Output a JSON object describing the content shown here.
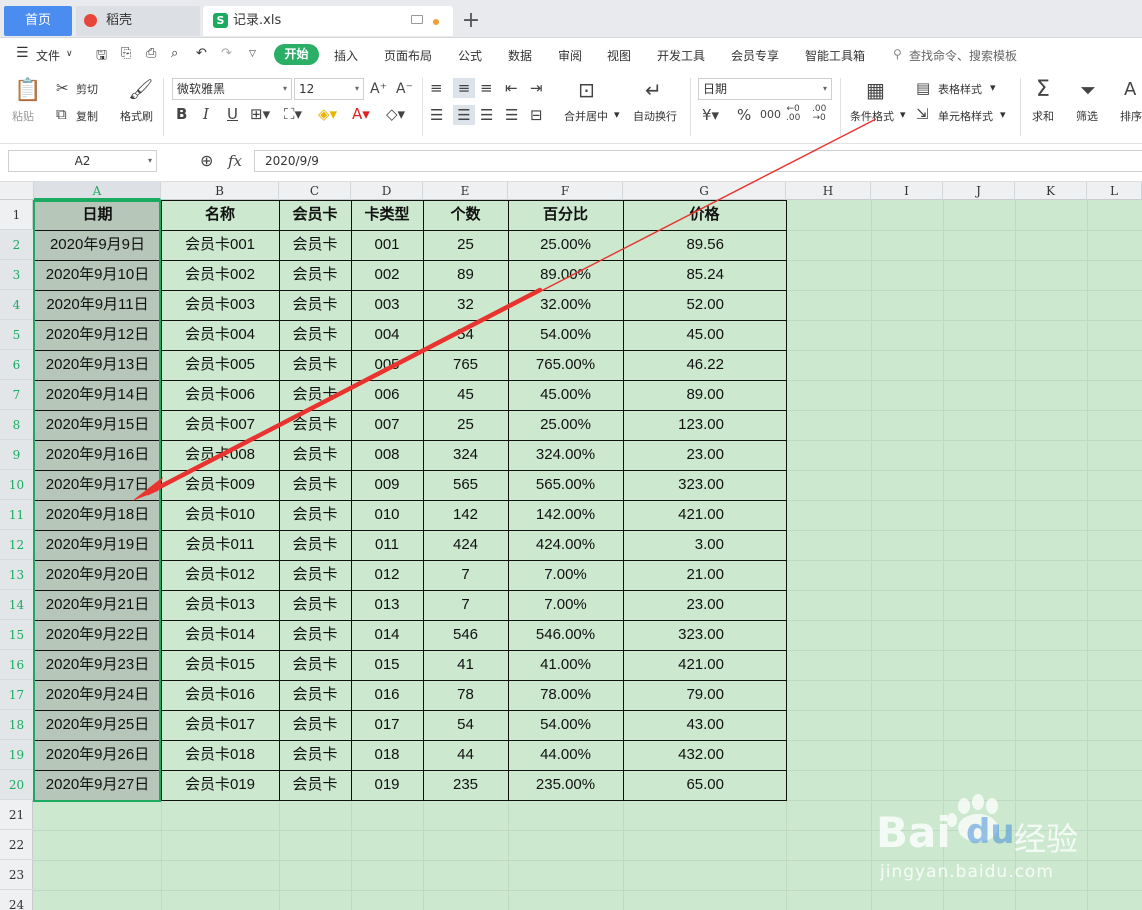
{
  "tabs": {
    "home": "首页",
    "daoke": "稻壳",
    "file": "记录.xls",
    "plus": "+"
  },
  "menu": {
    "file": "文件",
    "items": [
      "开始",
      "插入",
      "页面布局",
      "公式",
      "数据",
      "审阅",
      "视图",
      "开发工具",
      "会员专享",
      "智能工具箱"
    ],
    "search": "查找命令、搜索模板"
  },
  "ribbon": {
    "paste": "粘贴",
    "cut": "剪切",
    "copy": "复制",
    "format_painter": "格式刷",
    "font_name": "微软雅黑",
    "font_size": "12",
    "merge_center": "合并居中",
    "wrap": "自动换行",
    "number_format": "日期",
    "cond_format": "条件格式",
    "table_style": "表格样式",
    "cell_style": "单元格样式",
    "sum": "求和",
    "filter": "筛选",
    "sort": "排序"
  },
  "formula_bar": {
    "name_box": "A2",
    "fx": "fx",
    "value": "2020/9/9"
  },
  "columns": [
    "A",
    "B",
    "C",
    "D",
    "E",
    "F",
    "G",
    "H",
    "I",
    "J",
    "K",
    "L"
  ],
  "rows": [
    "1",
    "2",
    "3",
    "4",
    "5",
    "6",
    "7",
    "8",
    "9",
    "10",
    "11",
    "12",
    "13",
    "14",
    "15",
    "16",
    "17",
    "18",
    "19",
    "20",
    "21",
    "22",
    "23",
    "24"
  ],
  "table": {
    "headers": [
      "日期",
      "名称",
      "会员卡",
      "卡类型",
      "个数",
      "百分比",
      "价格"
    ],
    "data": [
      [
        "2020年9月9日",
        "会员卡001",
        "会员卡",
        "001",
        "25",
        "25.00%",
        "89.56"
      ],
      [
        "2020年9月10日",
        "会员卡002",
        "会员卡",
        "002",
        "89",
        "89.00%",
        "85.24"
      ],
      [
        "2020年9月11日",
        "会员卡003",
        "会员卡",
        "003",
        "32",
        "32.00%",
        "52.00"
      ],
      [
        "2020年9月12日",
        "会员卡004",
        "会员卡",
        "004",
        "54",
        "54.00%",
        "45.00"
      ],
      [
        "2020年9月13日",
        "会员卡005",
        "会员卡",
        "005",
        "765",
        "765.00%",
        "46.22"
      ],
      [
        "2020年9月14日",
        "会员卡006",
        "会员卡",
        "006",
        "45",
        "45.00%",
        "89.00"
      ],
      [
        "2020年9月15日",
        "会员卡007",
        "会员卡",
        "007",
        "25",
        "25.00%",
        "123.00"
      ],
      [
        "2020年9月16日",
        "会员卡008",
        "会员卡",
        "008",
        "324",
        "324.00%",
        "23.00"
      ],
      [
        "2020年9月17日",
        "会员卡009",
        "会员卡",
        "009",
        "565",
        "565.00%",
        "323.00"
      ],
      [
        "2020年9月18日",
        "会员卡010",
        "会员卡",
        "010",
        "142",
        "142.00%",
        "421.00"
      ],
      [
        "2020年9月19日",
        "会员卡011",
        "会员卡",
        "011",
        "424",
        "424.00%",
        "3.00"
      ],
      [
        "2020年9月20日",
        "会员卡012",
        "会员卡",
        "012",
        "7",
        "7.00%",
        "21.00"
      ],
      [
        "2020年9月21日",
        "会员卡013",
        "会员卡",
        "013",
        "7",
        "7.00%",
        "23.00"
      ],
      [
        "2020年9月22日",
        "会员卡014",
        "会员卡",
        "014",
        "546",
        "546.00%",
        "323.00"
      ],
      [
        "2020年9月23日",
        "会员卡015",
        "会员卡",
        "015",
        "41",
        "41.00%",
        "421.00"
      ],
      [
        "2020年9月24日",
        "会员卡016",
        "会员卡",
        "016",
        "78",
        "78.00%",
        "79.00"
      ],
      [
        "2020年9月25日",
        "会员卡017",
        "会员卡",
        "017",
        "54",
        "54.00%",
        "43.00"
      ],
      [
        "2020年9月26日",
        "会员卡018",
        "会员卡",
        "018",
        "44",
        "44.00%",
        "432.00"
      ],
      [
        "2020年9月27日",
        "会员卡019",
        "会员卡",
        "019",
        "235",
        "235.00%",
        "65.00"
      ]
    ]
  },
  "watermark": {
    "brand": "Bai",
    "brand2": "du",
    "cn": "经验",
    "url": "jingyan.baidu.com"
  },
  "colors": {
    "accent": "#2bae66",
    "sheet_bg": "#cce8cf",
    "arrow": "#e8332e"
  }
}
